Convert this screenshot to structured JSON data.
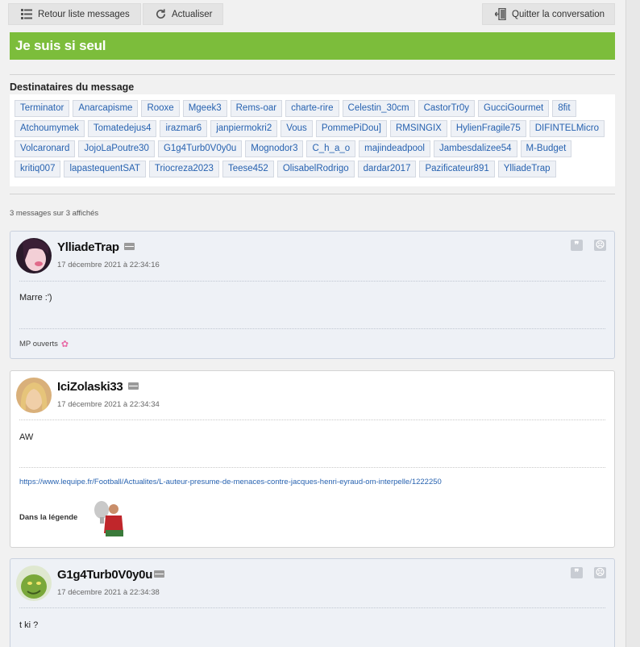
{
  "toolbar": {
    "back_label": "Retour liste messages",
    "refresh_label": "Actualiser",
    "quit_label": "Quitter la conversation"
  },
  "conversation": {
    "title": "Je suis si seul"
  },
  "recipients": {
    "label": "Destinataires du message",
    "items": [
      "Terminator",
      "Anarcapisme",
      "Rooxe",
      "Mgeek3",
      "Rems-oar",
      "charte-rire",
      "Celestin_30cm",
      "CastorTr0y",
      "GucciGourmet",
      "8fit",
      "Atchoumymek",
      "Tomatedejus4",
      "irazmar6",
      "janpiermokri2",
      "Vous",
      "PommePiDou]",
      "RMSINGIX",
      "HylienFragile75",
      "DIFINTELMicro",
      "Volcaronard",
      "JojoLaPoutre30",
      "G1g4Turb0V0y0u",
      "Mognodor3",
      "C_h_a_o",
      "majindeadpool",
      "Jambesdalizee54",
      "M-Budget",
      "kritiq007",
      "lapastequentSAT",
      "Triocreza2023",
      "Teese452",
      "OlisabelRodrigo",
      "dardar2017",
      "Pazificateur891",
      "YlliadeTrap"
    ]
  },
  "count_text": "3 messages sur 3 affichés",
  "messages": [
    {
      "author": "YlliadeTrap",
      "date": "17 décembre 2021 à 22:34:16",
      "text": "Marre :')",
      "signature": "MP ouverts",
      "signature_icon": "flower-icon"
    },
    {
      "author": "IciZolaski33",
      "date": "17 décembre 2021 à 22:34:34",
      "text": "AW",
      "link": "https://www.lequipe.fr/Football/Actualites/L-auteur-presume-de-menaces-contre-jacques-henri-eyraud-om-interpelle/1222250",
      "legend_label": "Dans la légende"
    },
    {
      "author": "G1g4Turb0V0y0u",
      "date": "17 décembre 2021 à 22:34:38",
      "text": "t ki ?"
    }
  ],
  "colors": {
    "title_bg": "#7cbd3b",
    "chip_text": "#2762b0",
    "chip_bg": "#eef1f6",
    "message_bg": "#eef1f6"
  }
}
